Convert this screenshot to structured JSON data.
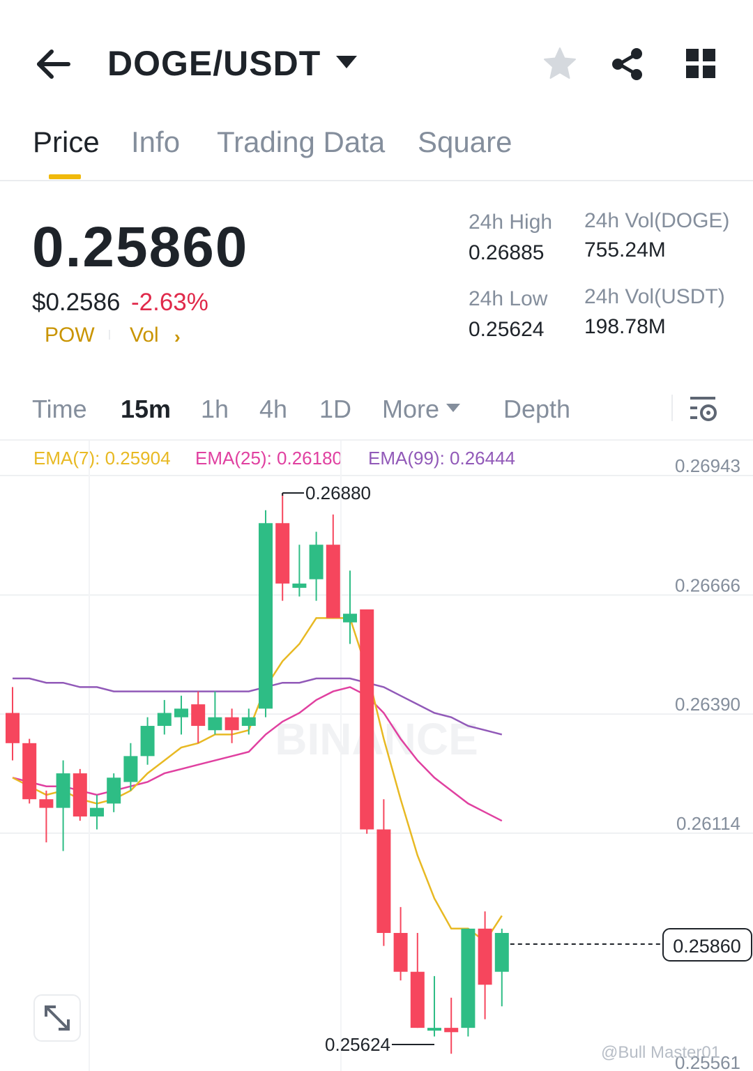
{
  "header": {
    "pair": "DOGE/USDT",
    "icons": [
      "back-arrow-icon",
      "chevron-down-icon",
      "star-icon",
      "share-icon",
      "grid-icon"
    ]
  },
  "tabs": [
    {
      "label": "Price",
      "active": true
    },
    {
      "label": "Info",
      "active": false
    },
    {
      "label": "Trading Data",
      "active": false
    },
    {
      "label": "Square",
      "active": false
    }
  ],
  "ticker": {
    "last_price": "0.25860",
    "fiat_price": "$0.2586",
    "change_pct": "-2.63%",
    "tags": [
      "POW",
      "Vol"
    ],
    "high_label": "24h High",
    "high_value": "0.26885",
    "low_label": "24h Low",
    "low_value": "0.25624",
    "vol_base_label": "24h Vol(DOGE)",
    "vol_base_value": "755.24M",
    "vol_quote_label": "24h Vol(USDT)",
    "vol_quote_value": "198.78M"
  },
  "intervals": {
    "items": [
      "Time",
      "15m",
      "1h",
      "4h",
      "1D",
      "More",
      "Depth"
    ],
    "active": "15m"
  },
  "ema": {
    "ema7": {
      "label": "EMA(7): 0.25904",
      "color": "#e8b923"
    },
    "ema25": {
      "label": "EMA(25): 0.26180",
      "color": "#e040a0"
    },
    "ema99": {
      "label": "EMA(99): 0.26444",
      "color": "#9159b8"
    }
  },
  "colors": {
    "up": "#2ebd85",
    "down": "#f6465d",
    "accent": "#f0b90b"
  },
  "chart_data": {
    "type": "candlestick",
    "interval": "15m",
    "y_ticks": [
      "0.26943",
      "0.26666",
      "0.26390",
      "0.26114",
      "0.25561"
    ],
    "ylim": [
      0.25561,
      0.26943
    ],
    "current_price": "0.25860",
    "max_label": "0.26880",
    "min_label": "0.25624",
    "candles": [
      {
        "o": 0.2637,
        "h": 0.2643,
        "c": 0.263,
        "l": 0.2626
      },
      {
        "o": 0.263,
        "h": 0.2631,
        "c": 0.2617,
        "l": 0.2616
      },
      {
        "o": 0.2617,
        "h": 0.2619,
        "c": 0.2615,
        "l": 0.2607
      },
      {
        "o": 0.2615,
        "h": 0.2626,
        "c": 0.2623,
        "l": 0.2605
      },
      {
        "o": 0.2623,
        "h": 0.2624,
        "c": 0.2613,
        "l": 0.2612
      },
      {
        "o": 0.2613,
        "h": 0.2618,
        "c": 0.2615,
        "l": 0.261
      },
      {
        "o": 0.2616,
        "h": 0.2623,
        "c": 0.2622,
        "l": 0.2614
      },
      {
        "o": 0.2621,
        "h": 0.263,
        "c": 0.2627,
        "l": 0.2619
      },
      {
        "o": 0.2627,
        "h": 0.2636,
        "c": 0.2634,
        "l": 0.2625
      },
      {
        "o": 0.2634,
        "h": 0.264,
        "c": 0.2637,
        "l": 0.2632
      },
      {
        "o": 0.2636,
        "h": 0.2641,
        "c": 0.2638,
        "l": 0.2632
      },
      {
        "o": 0.2639,
        "h": 0.2642,
        "c": 0.2634,
        "l": 0.263
      },
      {
        "o": 0.2633,
        "h": 0.2642,
        "c": 0.2636,
        "l": 0.2632
      },
      {
        "o": 0.2636,
        "h": 0.2638,
        "c": 0.2633,
        "l": 0.263
      },
      {
        "o": 0.2634,
        "h": 0.2638,
        "c": 0.2636,
        "l": 0.2632
      },
      {
        "o": 0.2638,
        "h": 0.2684,
        "c": 0.2681,
        "l": 0.2636
      },
      {
        "o": 0.2681,
        "h": 0.2688,
        "c": 0.2667,
        "l": 0.2663
      },
      {
        "o": 0.2666,
        "h": 0.2676,
        "c": 0.2667,
        "l": 0.2664
      },
      {
        "o": 0.2668,
        "h": 0.2679,
        "c": 0.2676,
        "l": 0.2663
      },
      {
        "o": 0.2676,
        "h": 0.2683,
        "c": 0.2659,
        "l": 0.2659
      },
      {
        "o": 0.2658,
        "h": 0.267,
        "c": 0.266,
        "l": 0.2653
      },
      {
        "o": 0.2661,
        "h": 0.2661,
        "c": 0.261,
        "l": 0.2609
      },
      {
        "o": 0.261,
        "h": 0.2617,
        "c": 0.2586,
        "l": 0.2583
      },
      {
        "o": 0.2586,
        "h": 0.2592,
        "c": 0.2577,
        "l": 0.2575
      },
      {
        "o": 0.2577,
        "h": 0.2586,
        "c": 0.2564,
        "l": 0.2564
      },
      {
        "o": 0.2564,
        "h": 0.2576,
        "c": 0.2564,
        "l": 0.2562
      },
      {
        "o": 0.2564,
        "h": 0.2571,
        "c": 0.2563,
        "l": 0.2558
      },
      {
        "o": 0.2564,
        "h": 0.2587,
        "c": 0.2587,
        "l": 0.2562
      },
      {
        "o": 0.2587,
        "h": 0.2591,
        "c": 0.2574,
        "l": 0.2566
      },
      {
        "o": 0.2577,
        "h": 0.2587,
        "c": 0.2586,
        "l": 0.2569
      }
    ],
    "ema7": [
      0.2622,
      0.262,
      0.2618,
      0.2619,
      0.2617,
      0.2616,
      0.2617,
      0.2619,
      0.2623,
      0.2626,
      0.2629,
      0.263,
      0.2632,
      0.2632,
      0.2633,
      0.2643,
      0.2649,
      0.2653,
      0.2659,
      0.2659,
      0.2659,
      0.2647,
      0.2631,
      0.2617,
      0.2604,
      0.2594,
      0.2587,
      0.2587,
      0.2584,
      0.259
    ],
    "ema25": [
      0.2622,
      0.2621,
      0.262,
      0.262,
      0.2619,
      0.2618,
      0.2619,
      0.262,
      0.2621,
      0.2623,
      0.2624,
      0.2625,
      0.2626,
      0.2627,
      0.2628,
      0.2632,
      0.2635,
      0.2637,
      0.264,
      0.2642,
      0.2643,
      0.2641,
      0.2637,
      0.2631,
      0.2626,
      0.2622,
      0.2619,
      0.2616,
      0.2614,
      0.2612
    ],
    "ema99": [
      0.2645,
      0.2645,
      0.2644,
      0.2644,
      0.2643,
      0.2643,
      0.2642,
      0.2642,
      0.2642,
      0.2642,
      0.2642,
      0.2642,
      0.2642,
      0.2642,
      0.2642,
      0.2643,
      0.2644,
      0.2644,
      0.2645,
      0.2645,
      0.2645,
      0.2644,
      0.2643,
      0.2641,
      0.2639,
      0.2637,
      0.2636,
      0.2634,
      0.2633,
      0.2632
    ]
  },
  "watermark": {
    "brand": "BINANCE",
    "user": "@Bull Master01"
  }
}
